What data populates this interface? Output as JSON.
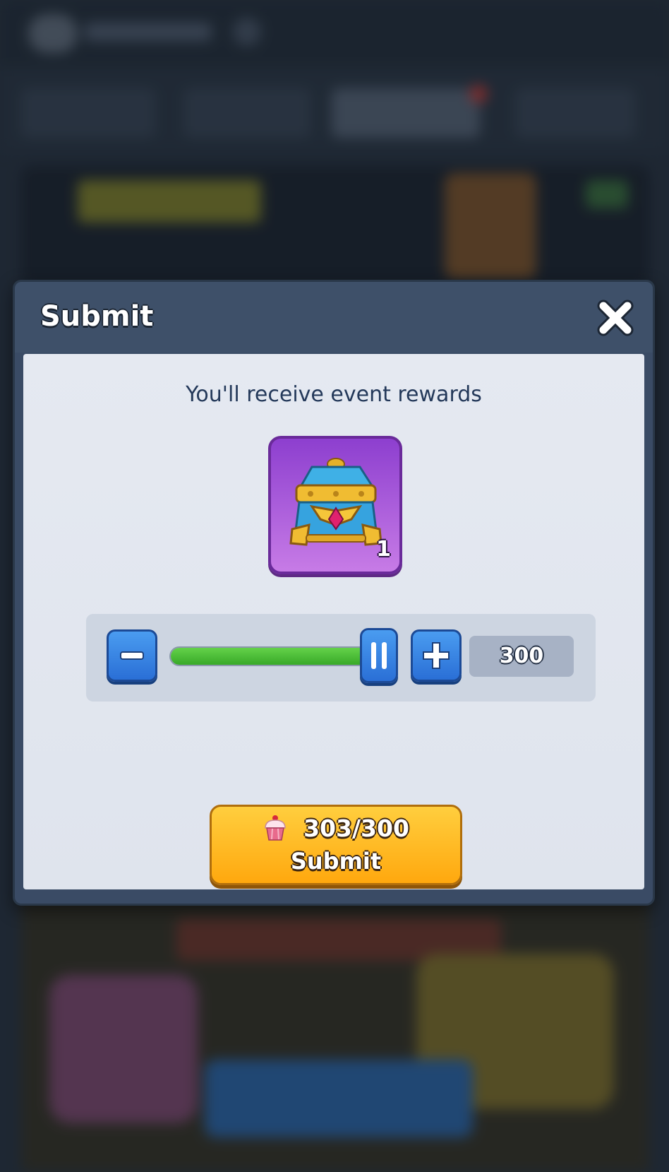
{
  "dialog": {
    "title": "Submit",
    "close_icon": "close-x-icon"
  },
  "body": {
    "subtitle": "You'll receive event rewards"
  },
  "reward": {
    "icon": "treasure-chest-icon",
    "count": "1"
  },
  "slider": {
    "minus_icon": "minus-icon",
    "plus_icon": "plus-icon",
    "handle_icon": "pause-grip-icon",
    "value": "300",
    "fill_fraction": 1.0
  },
  "submit": {
    "cost_icon": "cupcake-icon",
    "cost": "303/300",
    "label": "Submit"
  },
  "colors": {
    "accent_blue": "#2a6fd6",
    "slider_green": "#38a928",
    "submit_orange": "#ffa80e",
    "reward_purple": "#8d3fcf"
  }
}
